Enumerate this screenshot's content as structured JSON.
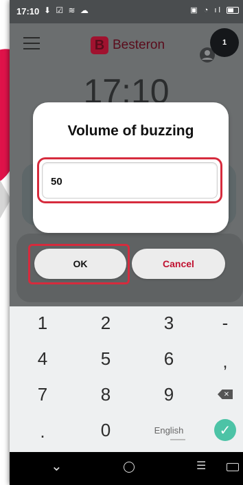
{
  "status": {
    "time": "17:10",
    "left_icons": "⬇ ☑ ≋ ☁",
    "right_icons": "▣ ◔ ıl"
  },
  "app": {
    "brand_letter": "B",
    "brand_name": "Besteron",
    "notification_count": "1",
    "clock": "17:10"
  },
  "dialog": {
    "title": "Volume of buzzing",
    "input_value": "50",
    "ok_label": "OK",
    "cancel_label": "Cancel"
  },
  "keyboard": {
    "keys": [
      "1",
      "2",
      "3",
      "-",
      "4",
      "5",
      "6",
      ",",
      "7",
      "8",
      "9",
      ".",
      "0"
    ],
    "language": "English",
    "done_symbol": "✓",
    "delete_symbol": "✕"
  },
  "navbar": {
    "back": "⌄",
    "recents": "☰"
  },
  "colors": {
    "accent_red": "#d62b3d",
    "cancel_red": "#c0102f",
    "done_green": "#4cc3a6",
    "brand": "#a0122f"
  }
}
